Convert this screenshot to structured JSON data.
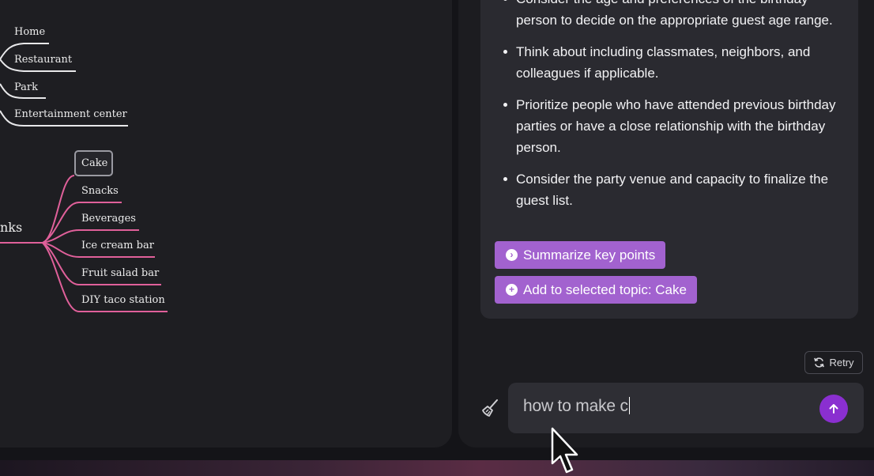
{
  "mindmap": {
    "top_branches": [
      "Home",
      "Restaurant",
      "Park",
      "Entertainment center"
    ],
    "parent_partial": "nks",
    "children": [
      "Cake",
      "Snacks",
      "Beverages",
      "Ice cream bar",
      "Fruit salad bar",
      "DIY taco station"
    ],
    "selected": "Cake",
    "branch_color": "#e0609a"
  },
  "chat": {
    "bullets": [
      "Consider the age and preferences of the birthday person to decide on the appropriate guest age range.",
      "Think about including classmates, neighbors, and colleagues if applicable.",
      "Prioritize people who have attended previous birthday parties or have a close relationship with the birthday person.",
      "Consider the party venue and capacity to finalize the guest list."
    ],
    "summarize_label": "Summarize key points",
    "add_topic_label": "Add to selected topic: Cake",
    "retry_label": "Retry",
    "input_value": "how to make c",
    "accent_color": "#a262cf",
    "send_color": "#8a2fd0"
  }
}
